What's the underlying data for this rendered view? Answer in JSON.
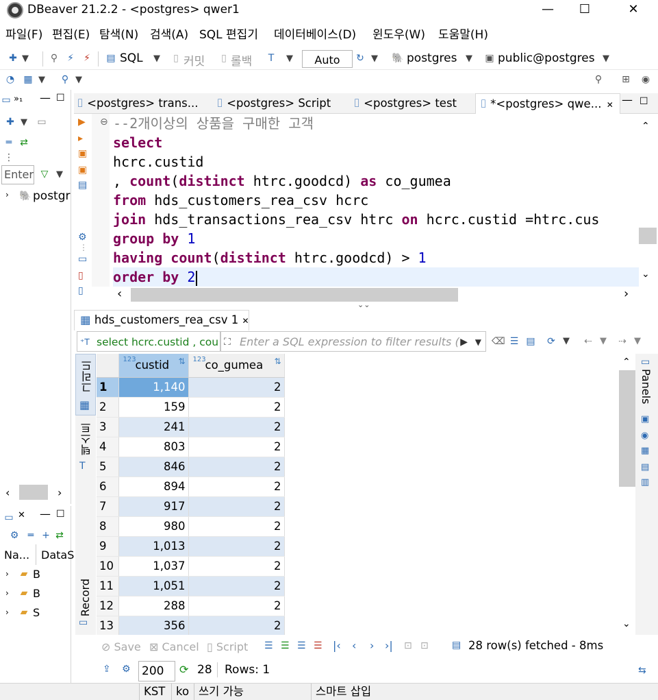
{
  "window": {
    "title": "DBeaver 21.2.2 - <postgres> qwer1",
    "minimize": "—",
    "maximize": "☐",
    "close": "✕"
  },
  "menu": [
    "파일(F)",
    "편집(E)",
    "탐색(N)",
    "검색(A)",
    "SQL 편집기",
    "데이터베이스(D)",
    "윈도우(W)",
    "도움말(H)"
  ],
  "toolbar": {
    "sql_label": "SQL",
    "commit_label": "커밋",
    "rollback_label": "롤백",
    "transaction_mode": "Auto",
    "datasource": "postgres",
    "schema": "public@postgres"
  },
  "navigator": {
    "filter_placeholder": "Enter",
    "tree_item": "postgr",
    "project_columns": [
      "Na...",
      "DataS"
    ],
    "project_items": [
      "B",
      "B",
      "S"
    ]
  },
  "editor_tabs": [
    {
      "label": "<postgres> trans..."
    },
    {
      "label": "<postgres> Script"
    },
    {
      "label": "<postgres> test"
    },
    {
      "label": "*<postgres> qwe..."
    }
  ],
  "editor_code": [
    [
      {
        "t": "--2개이상의 상품을 구매한 고객",
        "c": "cmt"
      }
    ],
    [
      {
        "t": "select",
        "c": "kw"
      }
    ],
    [
      {
        "t": "hcrc.custid",
        "c": ""
      }
    ],
    [
      {
        "t": ", ",
        "c": ""
      },
      {
        "t": "count",
        "c": "kw"
      },
      {
        "t": "(",
        "c": ""
      },
      {
        "t": "distinct",
        "c": "kw"
      },
      {
        "t": " htrc.goodcd) ",
        "c": ""
      },
      {
        "t": "as",
        "c": "kw"
      },
      {
        "t": " co_gumea",
        "c": ""
      }
    ],
    [
      {
        "t": "from",
        "c": "kw"
      },
      {
        "t": " hds_customers_rea_csv hcrc",
        "c": ""
      }
    ],
    [
      {
        "t": "join",
        "c": "kw"
      },
      {
        "t": " hds_transactions_rea_csv htrc ",
        "c": ""
      },
      {
        "t": "on",
        "c": "kw"
      },
      {
        "t": " hcrc.custid =htrc.cus",
        "c": ""
      }
    ],
    [
      {
        "t": "group by",
        "c": "kw"
      },
      {
        "t": " ",
        "c": ""
      },
      {
        "t": "1",
        "c": "num"
      }
    ],
    [
      {
        "t": "having",
        "c": "kw"
      },
      {
        "t": " ",
        "c": ""
      },
      {
        "t": "count",
        "c": "kw"
      },
      {
        "t": "(",
        "c": ""
      },
      {
        "t": "distinct",
        "c": "kw"
      },
      {
        "t": " htrc.goodcd) > ",
        "c": ""
      },
      {
        "t": "1",
        "c": "num"
      }
    ],
    [
      {
        "t": "order by",
        "c": "kw"
      },
      {
        "t": " ",
        "c": ""
      },
      {
        "t": "2",
        "c": "num"
      }
    ]
  ],
  "results": {
    "tab_label": "hds_customers_rea_csv 1",
    "sql_preview": "select hcrc.custid , cou",
    "filter_placeholder": "Enter a SQL expression to filter results (",
    "side_tabs": [
      "그리드",
      "텍스트",
      "Record"
    ],
    "right_panel_label": "Panels",
    "columns": [
      {
        "type": "123",
        "name": "custid"
      },
      {
        "type": "123",
        "name": "co_gumea"
      }
    ],
    "rows": [
      [
        "1",
        "1,140",
        "2"
      ],
      [
        "2",
        "159",
        "2"
      ],
      [
        "3",
        "241",
        "2"
      ],
      [
        "4",
        "803",
        "2"
      ],
      [
        "5",
        "846",
        "2"
      ],
      [
        "6",
        "894",
        "2"
      ],
      [
        "7",
        "917",
        "2"
      ],
      [
        "8",
        "980",
        "2"
      ],
      [
        "9",
        "1,013",
        "2"
      ],
      [
        "10",
        "1,037",
        "2"
      ],
      [
        "11",
        "1,051",
        "2"
      ],
      [
        "12",
        "288",
        "2"
      ],
      [
        "13",
        "356",
        "2"
      ]
    ],
    "save_label": "Save",
    "cancel_label": "Cancel",
    "script_label": "Script",
    "fetch_status": "28 row(s) fetched - 8ms",
    "fetch_size": "200",
    "row_count": "28",
    "rows_label": "Rows: 1"
  },
  "status_bar": {
    "timezone": "KST",
    "locale": "ko",
    "write_mode": "쓰기 가능",
    "insert_mode": "스마트 삽입"
  }
}
